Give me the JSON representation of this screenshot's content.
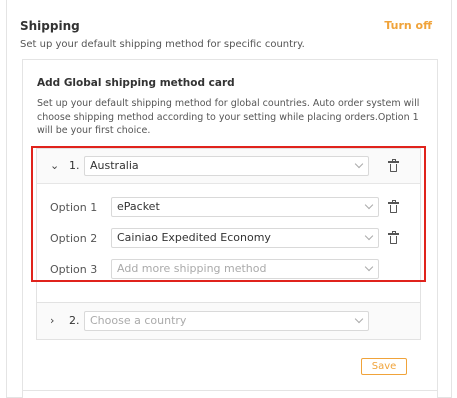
{
  "header": {
    "title": "Shipping",
    "turn_off": "Turn off",
    "description": "Set up your default shipping method for specific country."
  },
  "card": {
    "title": "Add Global shipping method card",
    "description": "Set up your default shipping method for global countries. Auto order system will choose shipping method according to your setting while placing orders.Option 1 will be your first choice."
  },
  "countries": [
    {
      "index": "1.",
      "country": "Australia",
      "options": [
        {
          "label": "Option 1",
          "value": "ePacket"
        },
        {
          "label": "Option 2",
          "value": "Cainiao Expedited Economy"
        },
        {
          "label": "Option 3",
          "placeholder": "Add more shipping method"
        }
      ]
    },
    {
      "index": "2.",
      "placeholder": "Choose a country"
    }
  ],
  "save_label": "Save",
  "colors": {
    "accent": "#f0a33a",
    "highlight": "#e0231c"
  }
}
